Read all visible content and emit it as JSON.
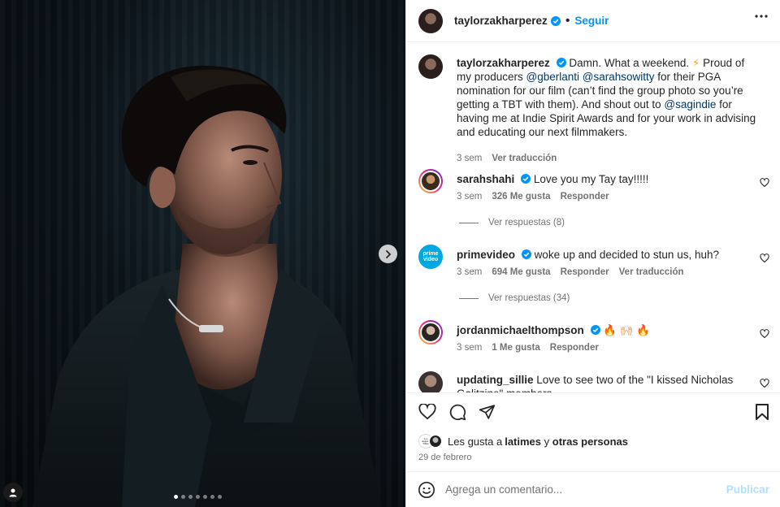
{
  "post": {
    "author": "taylorzakharperez",
    "follow_label": "Seguir",
    "separator": "•",
    "carousel": {
      "total": 7,
      "active_index": 0
    }
  },
  "caption": {
    "user": "taylorzakharperez",
    "parts": [
      "Damn. What a weekend. ",
      "⚡",
      " Proud of my producers ",
      "@gberlanti",
      " ",
      "@sarahsowitty",
      " for their PGA nomination for our film (can’t find the group photo so you’re getting a TBT with them). And shout out to ",
      "@sagindie",
      " for having me at Indie Spirit Awards and for your work in advising and educating our next filmmakers."
    ],
    "time": "3 sem",
    "translate": "Ver traducción"
  },
  "comments": [
    {
      "user": "sarahshahi",
      "text": "Love you my Tay tay!!!!!",
      "time": "3 sem",
      "likes": "326 Me gusta",
      "reply": "Responder",
      "translate": "",
      "view_replies": "Ver respuestas (8)"
    },
    {
      "user": "primevideo",
      "text": "woke up and decided to stun us, huh?",
      "time": "3 sem",
      "likes": "694 Me gusta",
      "reply": "Responder",
      "translate": "Ver traducción",
      "view_replies": "Ver respuestas (34)",
      "avatar_text": "prime video"
    },
    {
      "user": "jordanmichaelthompson",
      "text": "🔥 🙌🏻 🔥",
      "time": "3 sem",
      "likes": "1 Me gusta",
      "reply": "Responder",
      "translate": "",
      "view_replies": ""
    },
    {
      "user": "updating_sillie",
      "text": "Love to see two of the \"I kissed Nicholas Galitzine\" members",
      "time": "",
      "likes": "",
      "reply": "",
      "translate": "",
      "view_replies": ""
    }
  ],
  "engagement": {
    "likes_prefix": "Les gusta a ",
    "liked_by": "latimes",
    "likes_join": " y ",
    "others": "otras personas",
    "latimes_avatar_text": "Los Angeles Times",
    "date": "29 de febrero"
  },
  "composer": {
    "placeholder": "Agrega un comentario...",
    "publish": "Publicar"
  },
  "colors": {
    "link_blue": "#0095f6",
    "mention": "#00376b",
    "muted": "#737373",
    "verified": "#0095f6",
    "publish_disabled": "#b2dffc"
  },
  "icons": [
    "verified-icon",
    "more-options-icon",
    "heart-icon",
    "comment-icon",
    "share-icon",
    "bookmark-icon",
    "emoji-icon",
    "chevron-right-icon",
    "user-tag-icon"
  ]
}
